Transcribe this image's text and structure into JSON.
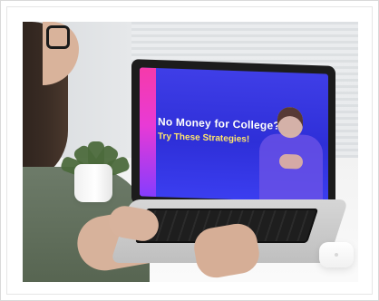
{
  "screen": {
    "title": "No Money for College?",
    "subtitle": "Try These Strategies!"
  }
}
